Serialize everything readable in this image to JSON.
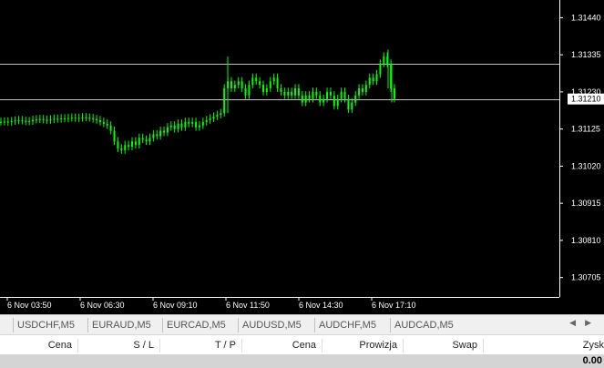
{
  "chart": {
    "symbol": "USDCHF,M5",
    "price_ticks": [
      "1.31440",
      "1.31335",
      "1.31230",
      "1.31125",
      "1.31020",
      "1.30915",
      "1.30810",
      "1.30705"
    ],
    "current_price": "1.31210",
    "time_ticks": [
      "6 Nov 03:50",
      "6 Nov 06:30",
      "6 Nov 09:10",
      "6 Nov 11:50",
      "6 Nov 14:30",
      "6 Nov 17:10"
    ],
    "y_range": [
      1.3065,
      1.3149
    ],
    "candle_color": "#00ff00",
    "background_color": "#000000",
    "hline_color": "#c0c0c0",
    "series": [
      1.31145,
      1.31146,
      1.31144,
      1.31147,
      1.31149,
      1.3115,
      1.31148,
      1.31146,
      1.31147,
      1.31151,
      1.31152,
      1.31153,
      1.31151,
      1.3115,
      1.31152,
      1.31154,
      1.31153,
      1.31155,
      1.31154,
      1.31156,
      1.31157,
      1.31155,
      1.31156,
      1.31158,
      1.31157,
      1.31156,
      1.31153,
      1.3115,
      1.31145,
      1.3114,
      1.31135,
      1.3112,
      1.3109,
      1.3107,
      1.31065,
      1.3108,
      1.31075,
      1.3109,
      1.3108,
      1.311,
      1.31095,
      1.3109,
      1.311,
      1.3111,
      1.31105,
      1.3112,
      1.31115,
      1.3113,
      1.31135,
      1.31125,
      1.3114,
      1.3113,
      1.31145,
      1.3114,
      1.31145,
      1.3113,
      1.31135,
      1.31145,
      1.3115,
      1.31155,
      1.3116,
      1.31165,
      1.3117,
      1.3124,
      1.3126,
      1.3124,
      1.3125,
      1.3126,
      1.3124,
      1.3122,
      1.3125,
      1.3127,
      1.3126,
      1.3125,
      1.3123,
      1.3124,
      1.3126,
      1.3127,
      1.3124,
      1.3123,
      1.3122,
      1.3123,
      1.3122,
      1.3124,
      1.3122,
      1.312,
      1.3122,
      1.3121,
      1.3123,
      1.3122,
      1.312,
      1.3121,
      1.3123,
      1.3122,
      1.3119,
      1.3121,
      1.3123,
      1.3121,
      1.3118,
      1.312,
      1.3122,
      1.3124,
      1.3123,
      1.3125,
      1.3127,
      1.3126,
      1.3128,
      1.3131,
      1.3133,
      1.3131,
      1.3124,
      1.3121
    ]
  },
  "symbol_tabs": [
    "USDCHF,M5",
    "EURAUD,M5",
    "EURCAD,M5",
    "AUDUSD,M5",
    "AUDCHF,M5",
    "AUDCAD,M5"
  ],
  "tab_scroll_left": "◀",
  "tab_scroll_right": "▶",
  "trade_columns": [
    "Cena",
    "S / L",
    "T / P",
    "Cena",
    "Prowizja",
    "Swap",
    "Zysk"
  ],
  "total_profit": "0.00"
}
